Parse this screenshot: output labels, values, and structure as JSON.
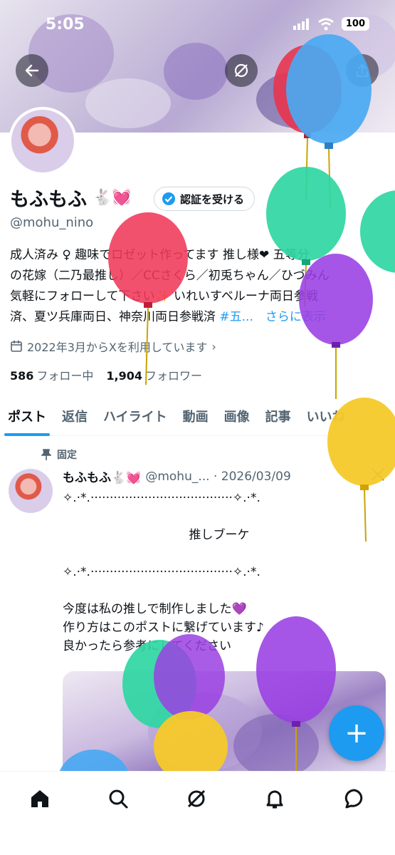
{
  "status_bar": {
    "time": "5:05",
    "battery": "100"
  },
  "profile": {
    "display_name": "もふもふ",
    "name_emoji": "🐇💓",
    "verify_label": "認証を受ける",
    "handle": "@mohu_nino",
    "bio_lines": [
      "成人済み ♀ 趣味でロゼット作ってます 推し様❤ 五等分",
      "の花嫁（二乃最推し）／CCさくら／初兎ちゃん／ひづみん",
      "気軽にフォローして下さい✨ いれいすベルーナ両日参戦",
      "済、夏ツ兵庫両日、神奈川両日参戦済"
    ],
    "bio_hashtag": "#五...",
    "bio_more": "さらに表示",
    "joined": "2022年3月からXを利用しています",
    "following_count": "586",
    "following_label": "フォロー中",
    "followers_count": "1,904",
    "followers_label": "フォロワー"
  },
  "tabs": [
    "ポスト",
    "返信",
    "ハイライト",
    "動画",
    "画像",
    "記事",
    "いいね"
  ],
  "post": {
    "pinned_label": "固定",
    "name": "もふもふ🐇💓",
    "handle_date": "@mohu_... · 2026/03/09",
    "lines": [
      "✧.·*.·····································✧.·*.",
      "",
      "推しブーケ",
      "",
      "✧.·*.·····································✧.·*.",
      "",
      "今度は私の推しで制作しました💜",
      "作り方はこのポストに繋げています♪",
      "良かったら参考にしてください"
    ]
  },
  "fab_label": "+",
  "colors": {
    "accent": "#1d9bf0",
    "text": "#0f1419",
    "muted": "#536471"
  },
  "icons": {
    "back": "arrow-left-icon",
    "grok": "grok-icon",
    "share": "share-icon",
    "calendar": "calendar-icon",
    "pin": "pin-icon",
    "x_logo": "x-logo-icon",
    "nav": [
      "home-icon",
      "search-icon",
      "grok-icon",
      "bell-icon",
      "messages-icon"
    ]
  }
}
